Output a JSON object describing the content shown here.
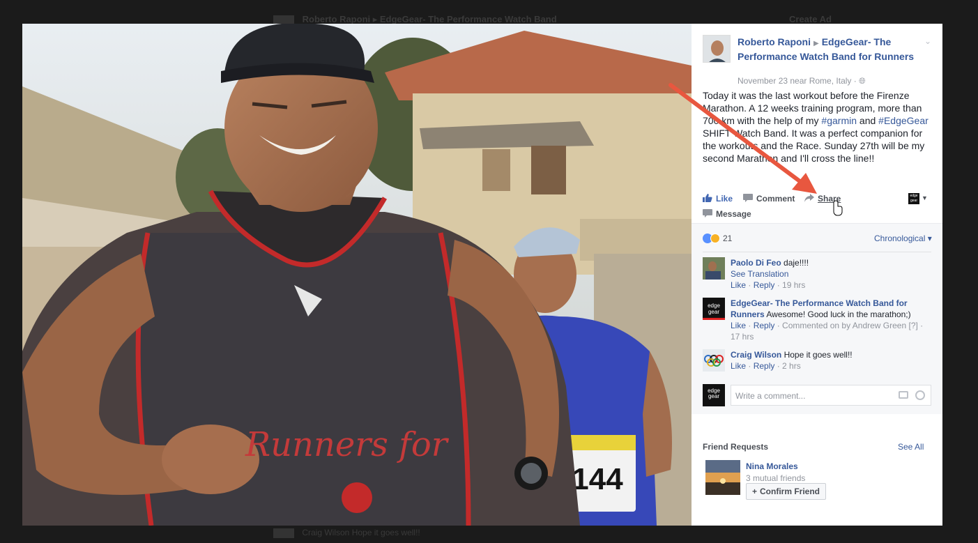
{
  "post": {
    "author": "Roberto Raponi",
    "page": "EdgeGear- The Performance Watch Band for Runners",
    "date": "November 23 near Rome, Italy",
    "privacy_icon": "globe-icon",
    "text_1": "Today it was the last workout before the Firenze Marathon. A 12 weeks training program, more than 700 km with the help of my ",
    "tag_garmin": "#garmin",
    "text_and": " and ",
    "tag_edgegear": "#EdgeGear",
    "text_2": " SHIFT Watch Band. It was a perfect companion for the workouts and the Race. Sunday 27th will be my second Marathon and I'll cross the line!!"
  },
  "actions": {
    "like": "Like",
    "comment": "Comment",
    "share": "Share",
    "message": "Message"
  },
  "reactions": {
    "count": "21",
    "sort": "Chronological"
  },
  "comments": [
    {
      "name": "Paolo Di Feo",
      "text": "daje!!!!",
      "see_translation": "See Translation",
      "like": "Like",
      "reply": "Reply",
      "time": "19 hrs"
    },
    {
      "name": "EdgeGear- The Performance Watch Band for Runners",
      "text": "Awesome! Good luck in the marathon;)",
      "like": "Like",
      "reply": "Reply",
      "commented_by": "Commented on by Andrew Green",
      "help": "[?]",
      "time": "17 hrs"
    },
    {
      "name": "Craig Wilson",
      "text": "Hope it goes well!!",
      "like": "Like",
      "reply": "Reply",
      "time": "2 hrs"
    }
  ],
  "composer": {
    "placeholder": "Write a comment..."
  },
  "friend_requests": {
    "heading": "Friend Requests",
    "see_all": "See All",
    "name": "Nina Morales",
    "mutual": "3 mutual friends",
    "confirm": "Confirm Friend"
  },
  "brand_logo_text": "edge gear",
  "bib_number": "144",
  "shirt_text": "Runners for",
  "ghost_top": {
    "left": "Roberto Raponi ▸ EdgeGear- The Performance Watch Band",
    "right": "Create Ad"
  },
  "ghost_bottom": "Craig Wilson Hope it goes well!!",
  "colors": {
    "link": "#365899",
    "like_blue": "#4267b2",
    "annotation_arrow": "#e8573f"
  }
}
